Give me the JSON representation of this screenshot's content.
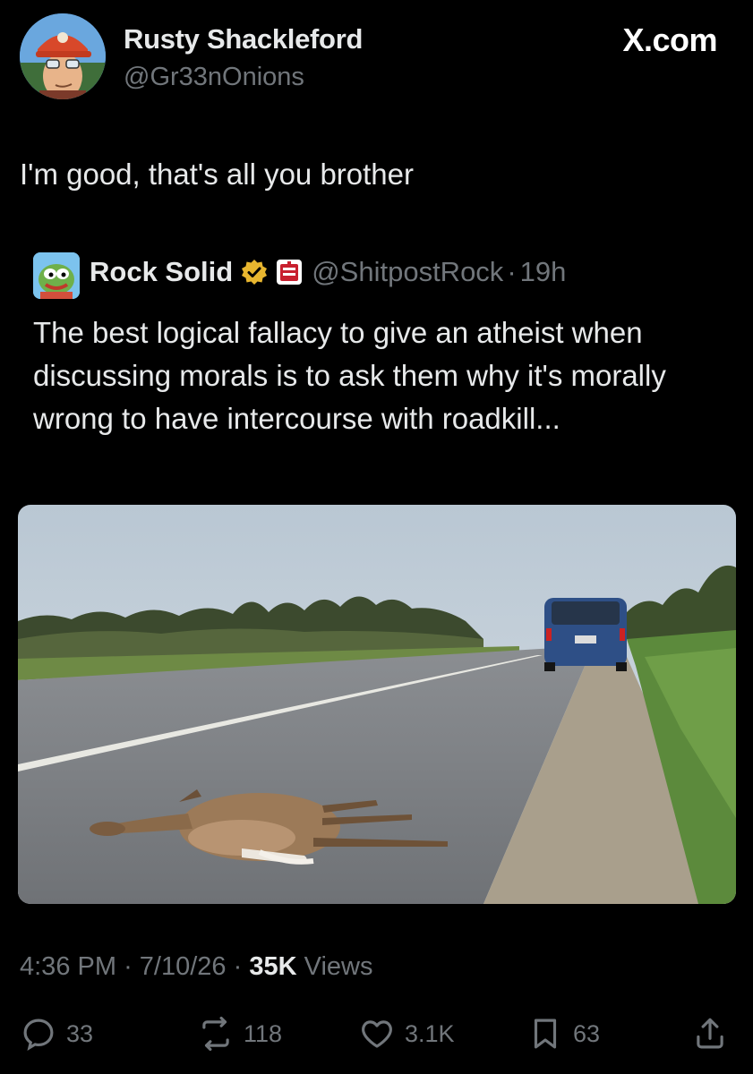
{
  "author": {
    "display_name": "Rusty Shackleford",
    "handle": "@Gr33nOnions"
  },
  "brand": "X.com",
  "tweet_text": "I'm good, that's all you brother",
  "quoted": {
    "display_name": "Rock Solid",
    "handle": "@ShitpostRock",
    "separator": "·",
    "time": "19h",
    "text": "The best logical fallacy to give an atheist when discussing morals is to ask them why it's morally wrong to have intercourse with roadkill..."
  },
  "meta": {
    "time": "4:36 PM",
    "date": "7/10/26",
    "views_count": "35K",
    "views_label": "Views",
    "sep": "·"
  },
  "actions": {
    "replies": "33",
    "reposts": "118",
    "likes": "3.1K",
    "bookmarks": "63"
  },
  "colors": {
    "background": "#000000",
    "text": "#e7e9ea",
    "muted": "#71767b",
    "verified_gold": "#e8b62f"
  }
}
